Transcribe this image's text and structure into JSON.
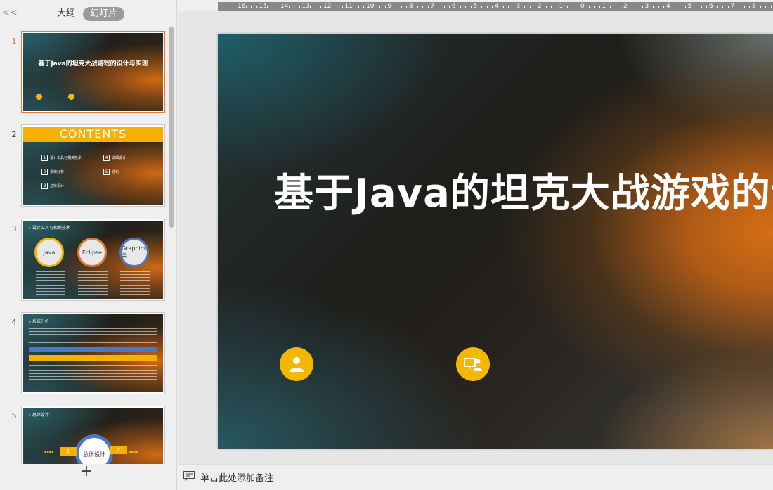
{
  "panel": {
    "collapse_glyph": "<<",
    "tabs": [
      {
        "label": "大纲"
      },
      {
        "label": "幻灯片"
      }
    ],
    "add_slide_glyph": "+"
  },
  "slides": [
    {
      "number": "1",
      "title": "基于Java的坦克大战游戏的设计与实现"
    },
    {
      "number": "2",
      "title": "CONTENTS",
      "items": [
        {
          "n": "1",
          "label": "设计工具与相关技术"
        },
        {
          "n": "2",
          "label": "系统分析"
        },
        {
          "n": "3",
          "label": "总体设计"
        },
        {
          "n": "4",
          "label": "详细设计"
        },
        {
          "n": "5",
          "label": "结论"
        }
      ]
    },
    {
      "number": "3",
      "title": "设计工具与相关技术",
      "circles": [
        "Java",
        "Eclipse",
        "Graphics类"
      ]
    },
    {
      "number": "4",
      "title": "系统分析"
    },
    {
      "number": "5",
      "title": "总体设计",
      "center": "总体设计",
      "tags": [
        "1",
        "2"
      ]
    }
  ],
  "main_slide": {
    "title": "基于Java的坦克大战游戏的设计与实现",
    "icons": [
      "author-icon",
      "teacher-icon"
    ]
  },
  "ruler": {
    "labels": [
      "16",
      "15",
      "14",
      "13",
      "12",
      "11",
      "10",
      "9",
      "8",
      "7",
      "6",
      "5",
      "4",
      "3",
      "2",
      "1",
      "0",
      "1",
      "2",
      "3",
      "4",
      "5",
      "6",
      "7",
      "8",
      "9"
    ]
  },
  "notes": {
    "placeholder": "单击此处添加备注"
  },
  "colors": {
    "accent_yellow": "#f5b800",
    "active_border": "#e07b39",
    "blue": "#4a78c4"
  }
}
